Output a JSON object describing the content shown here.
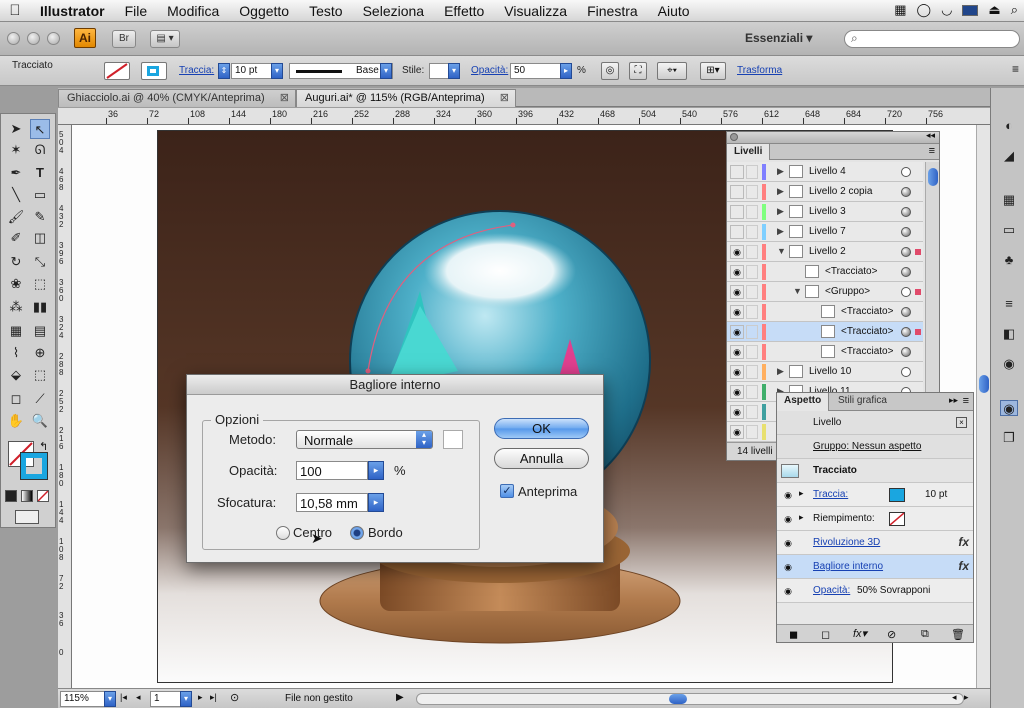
{
  "menubar": {
    "app_name": "Illustrator",
    "items": [
      "File",
      "Modifica",
      "Oggetto",
      "Testo",
      "Seleziona",
      "Effetto",
      "Visualizza",
      "Finestra",
      "Aiuto"
    ]
  },
  "appbar": {
    "logo": "Ai",
    "bridge": "Br",
    "workspace": "Essenziali ▾",
    "search_placeholder": ""
  },
  "control": {
    "selection_type": "Tracciato",
    "stroke_label": "Traccia:",
    "stroke_weight": "10 pt",
    "profile": "Base",
    "style_label": "Stile:",
    "opacity_label": "Opacità:",
    "opacity_value": "50",
    "opacity_unit": "%",
    "transform_label": "Trasforma"
  },
  "tabs": [
    {
      "label": "Ghiacciolo.ai @ 40% (CMYK/Anteprima)",
      "close": "⊠"
    },
    {
      "label": "Auguri.ai* @ 115% (RGB/Anteprima)",
      "close": "⊠"
    }
  ],
  "ruler": {
    "h_ticks": [
      "36",
      "72",
      "108",
      "144",
      "180",
      "216",
      "252",
      "288",
      "324",
      "360",
      "396",
      "432",
      "468",
      "504",
      "540",
      "576",
      "612",
      "648",
      "684",
      "720",
      "756"
    ],
    "v_ticks": [
      "504",
      "468",
      "432",
      "396",
      "360",
      "324",
      "288",
      "252",
      "216",
      "180",
      "144",
      "108",
      "72",
      "36",
      "0"
    ]
  },
  "layers_panel": {
    "tab": "Livelli",
    "rows": [
      {
        "name": "Livello 4",
        "color": "#7f7fff",
        "visible": false,
        "expanded": false,
        "indent": 0,
        "target_filled": false,
        "selected": false
      },
      {
        "name": "Livello 2 copia",
        "color": "#ff7f7f",
        "visible": false,
        "expanded": false,
        "indent": 0,
        "target_filled": true,
        "selected": false
      },
      {
        "name": "Livello 3",
        "color": "#7fff7f",
        "visible": false,
        "expanded": false,
        "indent": 0,
        "target_filled": true,
        "selected": false
      },
      {
        "name": "Livello 7",
        "color": "#7fcfff",
        "visible": false,
        "expanded": false,
        "indent": 0,
        "target_filled": true,
        "selected": false
      },
      {
        "name": "Livello 2",
        "color": "#ff7f7f",
        "visible": true,
        "expanded": true,
        "indent": 0,
        "target_filled": true,
        "selected": false
      },
      {
        "name": "<Tracciato>",
        "color": "#ff7f7f",
        "visible": true,
        "expanded": null,
        "indent": 1,
        "target_filled": true,
        "selected": false
      },
      {
        "name": "<Gruppo>",
        "color": "#ff7f7f",
        "visible": true,
        "expanded": true,
        "indent": 1,
        "target_filled": false,
        "selected": false
      },
      {
        "name": "<Tracciato>",
        "color": "#ff7f7f",
        "visible": true,
        "expanded": null,
        "indent": 2,
        "target_filled": true,
        "selected": false
      },
      {
        "name": "<Tracciato>",
        "color": "#ff7f7f",
        "visible": true,
        "expanded": null,
        "indent": 2,
        "target_filled": true,
        "selected": true
      },
      {
        "name": "<Tracciato>",
        "color": "#ff7f7f",
        "visible": true,
        "expanded": null,
        "indent": 2,
        "target_filled": true,
        "selected": false
      },
      {
        "name": "Livello 10",
        "color": "#ffaf5f",
        "visible": true,
        "expanded": false,
        "indent": 0,
        "target_filled": false,
        "selected": false
      },
      {
        "name": "Livello 11",
        "color": "#3fae6b",
        "visible": true,
        "expanded": false,
        "indent": 0,
        "target_filled": false,
        "selected": false
      },
      {
        "name": "",
        "color": "#3fa0a0",
        "visible": true,
        "expanded": false,
        "indent": 0,
        "target_filled": false,
        "selected": false
      },
      {
        "name": "",
        "color": "#e8e070",
        "visible": true,
        "expanded": false,
        "indent": 0,
        "target_filled": false,
        "selected": false
      }
    ],
    "footer": "14 livelli"
  },
  "appearance_panel": {
    "tab": "Aspetto",
    "tab2": "Stili grafica",
    "header": "Livello",
    "group_line": "Gruppo: Nessun aspetto",
    "object": "Tracciato",
    "stroke_label": "Traccia:",
    "stroke_value": "10 pt",
    "fill_label": "Riempimento:",
    "effect1": "Rivoluzione 3D",
    "effect2": "Bagliore interno",
    "opacity_label": "Opacità:",
    "opacity_value": "50% Sovrapponi",
    "fx": "fx"
  },
  "dialog": {
    "title": "Bagliore interno",
    "group": "Opzioni",
    "method_label": "Metodo:",
    "method_value": "Normale",
    "opacity_label": "Opacità:",
    "opacity_value": "100",
    "opacity_unit": "%",
    "blur_label": "Sfocatura:",
    "blur_value": "10,58 mm",
    "center_label": "Centro",
    "edge_label": "Bordo",
    "ok": "OK",
    "cancel": "Annulla",
    "preview_label": "Anteprima",
    "preview_checked": true,
    "edge_selected": true
  },
  "status": {
    "zoom": "115%",
    "page": "1",
    "info": "File non gestito"
  },
  "colors": {
    "stroke_blue": "#1aa6e0",
    "accent": "#3c7fe0"
  }
}
